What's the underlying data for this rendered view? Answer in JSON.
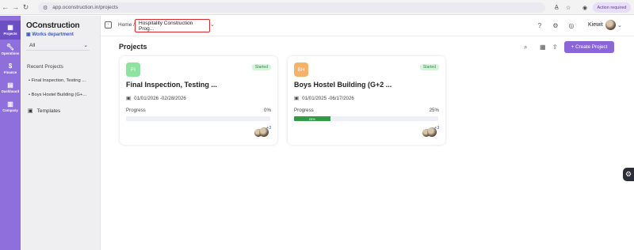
{
  "browser": {
    "url": "app.oconstruction.in/projects",
    "action_pill": "Action required"
  },
  "rail": {
    "items": [
      {
        "label": "Projects",
        "icon": "building-icon"
      },
      {
        "label": "Operations",
        "icon": "wrench-icon"
      },
      {
        "label": "Finance",
        "icon": "dollar-icon"
      },
      {
        "label": "Dashboard",
        "icon": "dashboard-icon"
      },
      {
        "label": "Company",
        "icon": "company-icon"
      }
    ]
  },
  "sidebar": {
    "logo": "OConstruction",
    "department": "Works department",
    "filter_value": "All",
    "recent_heading": "Recent Projects",
    "recent": [
      "Final Inspection, Testing ...",
      "Boys Hostel Building (G+..."
    ],
    "templates_label": "Templates"
  },
  "header": {
    "breadcrumb_home": "Home /",
    "breadcrumb_current": "Hospitality Construction Prog...",
    "user_name": "Kiewit"
  },
  "main": {
    "title": "Projects",
    "create_label": "+ Create Project"
  },
  "projects": [
    {
      "initials": "FI",
      "status": "Started",
      "title": "Final Inspection, Testing ...",
      "dates": "01/01/2026 -02/28/2026",
      "progress_label": "Progress",
      "progress_text": "0%",
      "progress": 0,
      "members_more": "+3",
      "badge_color": "#8fe3a0"
    },
    {
      "initials": "BH",
      "status": "Started",
      "title": "Boys Hostel Building (G+2 ...",
      "dates": "01/01/2025 -06/17/2026",
      "progress_label": "Progress",
      "progress_text": "25%",
      "progress_bar_text": "25%",
      "progress": 25,
      "members_more": "+3",
      "badge_color": "#f7b26a"
    }
  ]
}
